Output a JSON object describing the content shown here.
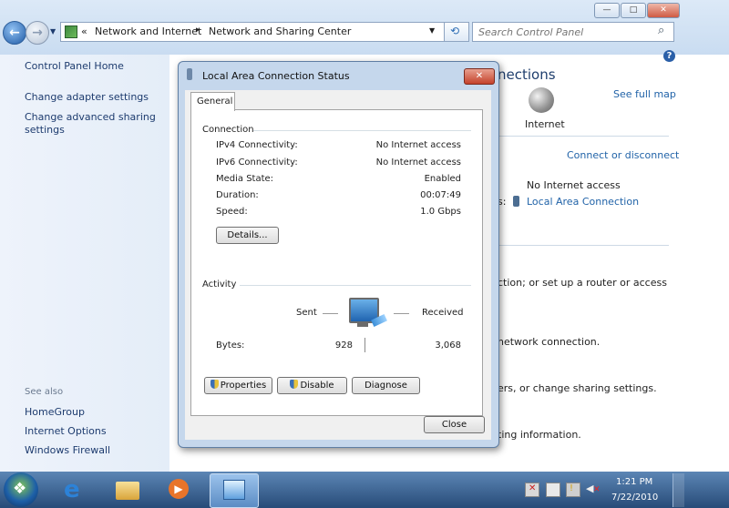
{
  "titlebar": {
    "min_label": "—",
    "max_label": "□",
    "close_label": "✕"
  },
  "address": {
    "breadcrumb_prefix": "«",
    "crumbs": [
      "Network and Internet",
      "Network and Sharing Center"
    ],
    "sep": "▸"
  },
  "search": {
    "placeholder": "Search Control Panel"
  },
  "sidebar": {
    "home": "Control Panel Home",
    "items": [
      "Change adapter settings",
      "Change advanced sharing\nsettings"
    ],
    "see_also_heading": "See also",
    "see_also": [
      "HomeGroup",
      "Internet Options",
      "Windows Firewall"
    ]
  },
  "main": {
    "heading_fragment": "nections",
    "see_full_map": "See full map",
    "internet_label": "Internet",
    "connect_or_disconnect": "Connect or disconnect",
    "access_value": "No Internet access",
    "connections_fragment": "s:",
    "connection_link": "Local Area Connection",
    "task1_fragment": "ction; or set up a router or access",
    "task2_fragment": "network connection.",
    "task3_fragment": "ers, or change sharing settings.",
    "task4_fragment": "ting information."
  },
  "dialog": {
    "title": "Local Area Connection Status",
    "close_label": "✕",
    "tab_general": "General",
    "connection_heading": "Connection",
    "rows": [
      {
        "label": "IPv4 Connectivity:",
        "value": "No Internet access"
      },
      {
        "label": "IPv6 Connectivity:",
        "value": "No Internet access"
      },
      {
        "label": "Media State:",
        "value": "Enabled"
      },
      {
        "label": "Duration:",
        "value": "00:07:49"
      },
      {
        "label": "Speed:",
        "value": "1.0 Gbps"
      }
    ],
    "details_button": "Details...",
    "activity_heading": "Activity",
    "sent_label": "Sent",
    "received_label": "Received",
    "bytes_label": "Bytes:",
    "bytes_sent": "928",
    "bytes_received": "3,068",
    "properties_button": "Properties",
    "disable_button": "Disable",
    "diagnose_button": "Diagnose",
    "close_button": "Close"
  },
  "taskbar": {
    "time": "1:21 PM",
    "date": "7/22/2010"
  },
  "colors": {
    "accent": "#2163a8",
    "taskbar": "#3a6394",
    "dialog_frame": "#c5d7ec"
  }
}
